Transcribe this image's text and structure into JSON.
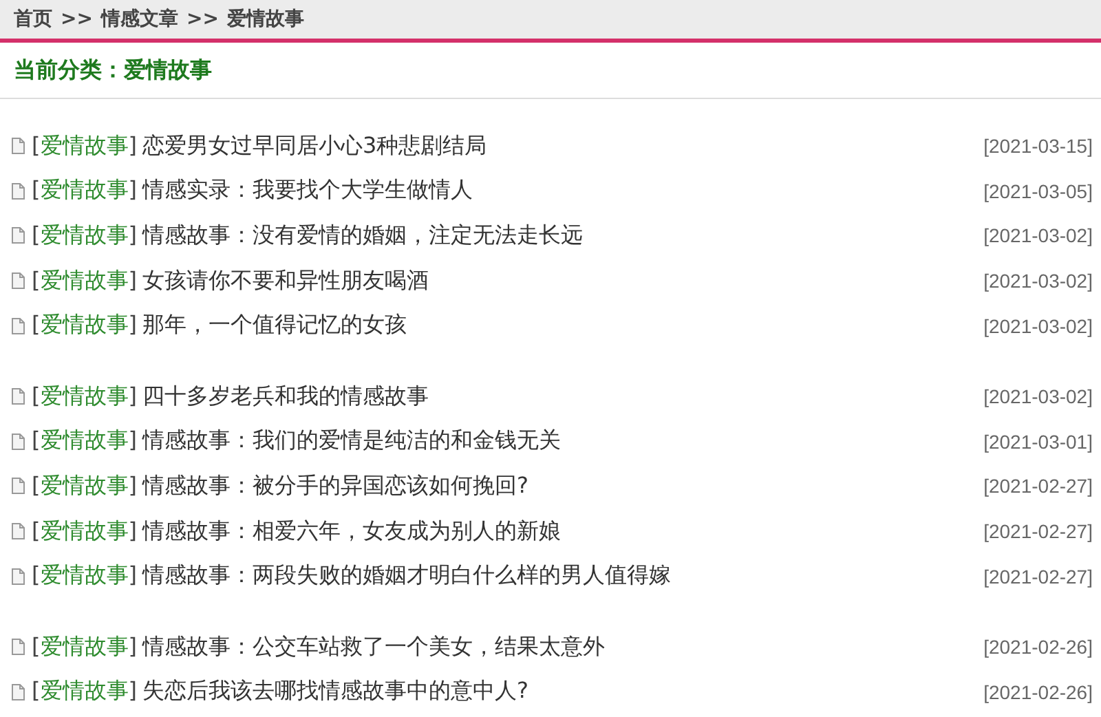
{
  "breadcrumb": [
    "首页",
    ">>",
    "情感文章",
    ">>",
    "爱情故事"
  ],
  "category_heading": "当前分类：爱情故事",
  "groups": [
    [
      {
        "tag": "[爱情故事]",
        "title": "恋爱男女过早同居小心3种悲剧结局",
        "date": "[2021-03-15]"
      },
      {
        "tag": "[爱情故事]",
        "title": "情感实录：我要找个大学生做情人",
        "date": "[2021-03-05]"
      },
      {
        "tag": "[爱情故事]",
        "title": "情感故事：没有爱情的婚姻，注定无法走长远",
        "date": "[2021-03-02]"
      },
      {
        "tag": "[爱情故事]",
        "title": "女孩请你不要和异性朋友喝酒",
        "date": "[2021-03-02]"
      },
      {
        "tag": "[爱情故事]",
        "title": "那年，一个值得记忆的女孩",
        "date": "[2021-03-02]"
      }
    ],
    [
      {
        "tag": "[爱情故事]",
        "title": "四十多岁老兵和我的情感故事",
        "date": "[2021-03-02]"
      },
      {
        "tag": "[爱情故事]",
        "title": "情感故事：我们的爱情是纯洁的和金钱无关",
        "date": "[2021-03-01]"
      },
      {
        "tag": "[爱情故事]",
        "title": "情感故事：被分手的异国恋该如何挽回?",
        "date": "[2021-02-27]"
      },
      {
        "tag": "[爱情故事]",
        "title": "情感故事：相爱六年，女友成为别人的新娘",
        "date": "[2021-02-27]"
      },
      {
        "tag": "[爱情故事]",
        "title": "情感故事：两段失败的婚姻才明白什么样的男人值得嫁",
        "date": "[2021-02-27]"
      }
    ],
    [
      {
        "tag": "[爱情故事]",
        "title": "情感故事：公交车站救了一个美女，结果太意外",
        "date": "[2021-02-26]"
      },
      {
        "tag": "[爱情故事]",
        "title": "失恋后我该去哪找情感故事中的意中人?",
        "date": "[2021-02-26]"
      }
    ]
  ]
}
